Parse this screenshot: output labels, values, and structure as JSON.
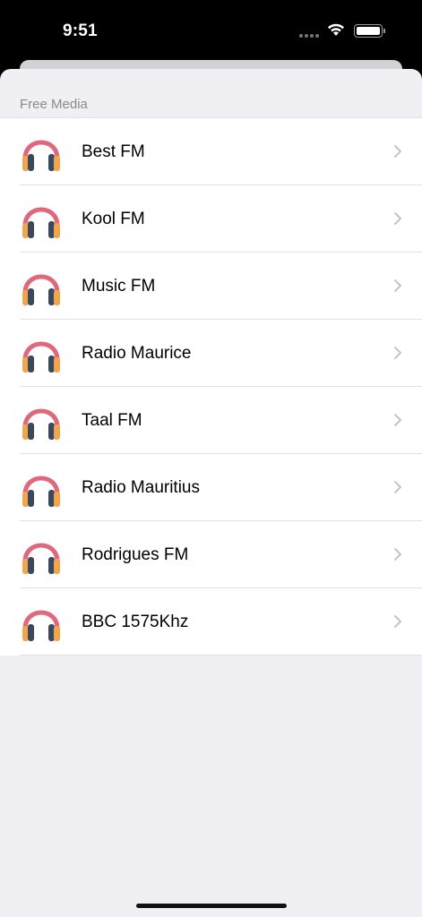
{
  "status_bar": {
    "time": "9:51"
  },
  "section": {
    "header": "Free Media",
    "items": [
      {
        "label": "Best FM"
      },
      {
        "label": "Kool FM"
      },
      {
        "label": "Music FM"
      },
      {
        "label": "Radio Maurice"
      },
      {
        "label": "Taal FM"
      },
      {
        "label": "Radio Mauritius"
      },
      {
        "label": "Rodrigues FM"
      },
      {
        "label": "BBC 1575Khz"
      }
    ]
  },
  "icons": {
    "row_icon": "headphones-icon",
    "row_accessory": "chevron-right-icon"
  },
  "colors": {
    "headband": "#e0687c",
    "cup_dark": "#3a4a5c",
    "cup_orange": "#f2a54a",
    "background": "#efeff4",
    "chevron": "#c4c4c7"
  }
}
